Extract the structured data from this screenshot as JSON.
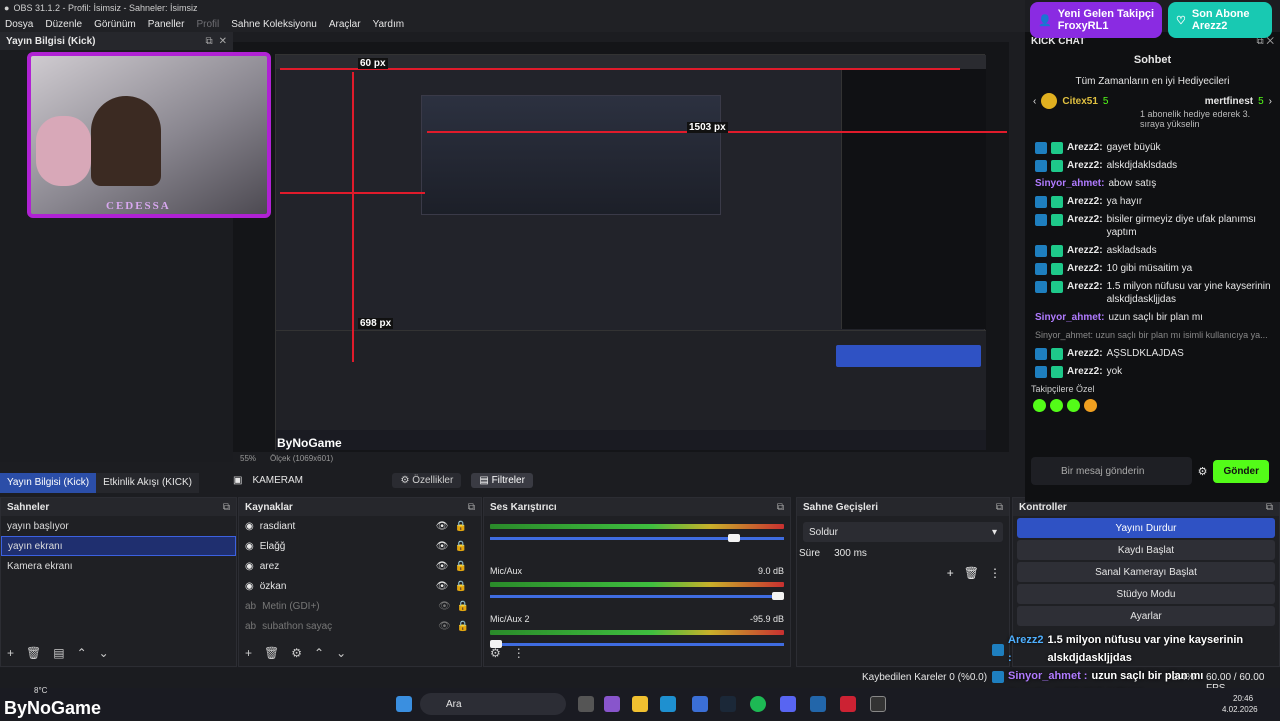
{
  "window": {
    "title": "OBS 31.1.2 - Profil: İsimsiz - Sahneler: İsimsiz"
  },
  "menu": [
    "Dosya",
    "Düzenle",
    "Görünüm",
    "Paneller",
    "Profil",
    "Sahne Koleksiyonu",
    "Araçlar",
    "Yardım"
  ],
  "info_dock": {
    "title": "Yayın Bilgisi (Kick)"
  },
  "preview": {
    "measure_top": "60 px",
    "measure_right": "1503 px",
    "measure_bottom": "698 px",
    "zoom": "55%",
    "scale": "Ölçek (1069x601)",
    "watermark": "ByNoGame"
  },
  "camera": {
    "tag": "CEDESSA"
  },
  "bottom_tabs": [
    "Yayın Bilgisi (Kick)",
    "Etkinlik Akışı (KICK)"
  ],
  "scene_bar": {
    "scene_name": "KAMERAM",
    "properties": "Özellikler",
    "filters": "Filtreler"
  },
  "scenes": {
    "title": "Sahneler",
    "items": [
      "yayın başlıyor",
      "yayın ekranı",
      "Kamera ekranı"
    ],
    "selected": 1
  },
  "sources": {
    "title": "Kaynaklar",
    "items": [
      {
        "name": "rasdiant",
        "dim": false
      },
      {
        "name": "Elağğ",
        "dim": false
      },
      {
        "name": "arez",
        "dim": false
      },
      {
        "name": "özkan",
        "dim": false
      },
      {
        "name": "Metin (GDI+)",
        "dim": true
      },
      {
        "name": "subathon sayaç",
        "dim": true
      }
    ]
  },
  "mixer": {
    "title": "Ses Karıştırıcı",
    "ticks": [
      "-60",
      "-55",
      "-50",
      "-45",
      "-40",
      "-35",
      "-30",
      "-25",
      "-20",
      "-15",
      "-10",
      "-5",
      "0"
    ],
    "tracks": [
      {
        "name": "",
        "db": "",
        "volume": 0.85
      },
      {
        "name": "Mic/Aux",
        "db": "9.0 dB",
        "volume": 1.0
      },
      {
        "name": "Mic/Aux 2",
        "db": "-95.9 dB",
        "volume": 0.03
      }
    ]
  },
  "transitions": {
    "title": "Sahne Geçişleri",
    "type": "Soldur",
    "duration_label": "Süre",
    "duration": "300 ms"
  },
  "controls": {
    "title": "Kontroller",
    "buttons": [
      "Yayını Durdur",
      "Kaydı Başlat",
      "Sanal Kamerayı Başlat",
      "Stüdyo Modu",
      "Ayarlar"
    ]
  },
  "chat": {
    "dock_title": "KICK CHAT",
    "header": "Sohbet",
    "top_title": "Tüm Zamanların en iyi Hediyecileri",
    "top1_name": "Citex51",
    "top1_count": "5",
    "top2_name": "mertfinest",
    "top2_count": "5",
    "top2_note": "1 abonelik hediye ederek 3. sıraya yükselin",
    "messages": [
      {
        "user": "Arezz2:",
        "text": "gayet büyük",
        "badges": true
      },
      {
        "user": "Arezz2:",
        "text": "alskdjdaklsdads",
        "badges": true
      },
      {
        "user": "Sinyor_ahmet:",
        "text": "abow satış",
        "badges": false
      },
      {
        "user": "Arezz2:",
        "text": "ya hayır",
        "badges": true
      },
      {
        "user": "Arezz2:",
        "text": "bisiler girmeyiz diye ufak planımsı yaptım",
        "badges": true
      },
      {
        "user": "Arezz2:",
        "text": "askladsads",
        "badges": true
      },
      {
        "user": "Arezz2:",
        "text": "10 gibi müsaitim ya",
        "badges": true
      },
      {
        "user": "Arezz2:",
        "text": "1.5 milyon nüfusu var yine kayserinin alskdjdaskljjdas",
        "badges": true
      },
      {
        "user": "Sinyor_ahmet:",
        "text": "uzun saçlı bir plan mı",
        "badges": false
      },
      {
        "user": "",
        "text": "Sinyor_ahmet: uzun saçlı bir plan mı isimli kullanıcıya ya...",
        "badges": false,
        "reply": true
      },
      {
        "user": "Arezz2:",
        "text": "AŞSLDKLAJDAS",
        "badges": true
      },
      {
        "user": "Arezz2:",
        "text": "yok",
        "badges": true
      }
    ],
    "subs_label": "Takipçilere Özel",
    "input_placeholder": "Bir mesaj gönderin",
    "send": "Gönder"
  },
  "alerts": {
    "follower_title": "Yeni Gelen Takipçi",
    "follower_name": "FroxyRL1",
    "sub_title": "Son Abone",
    "sub_name": "Arezz2"
  },
  "overlay_chat": [
    {
      "user": "Arezz2 :",
      "text": "1.5 milyon nüfusu var yine kayserinin alskdjdaskljjdas"
    },
    {
      "user": "Sinyor_ahmet :",
      "text": "uzun saçlı bir plan mı"
    },
    {
      "user": "Arezz2 :",
      "text": "AŞSLDKLAJDAS"
    },
    {
      "user": "Arezz2 :",
      "text": "yok"
    }
  ],
  "status": {
    "dropped": "Kaybedilen Kareler 0 (%0.0)",
    "cpu": "2.4%",
    "fps": "60.00 / 60.00 FPS"
  },
  "taskbar": {
    "weather": "8°C",
    "search": "Ara",
    "time": "20:46",
    "date": "4.02.2026",
    "logo": "ByNoGame"
  },
  "colors": {
    "accent": "#2f52c4",
    "kick_green": "#53fc18",
    "alert_purple": "#8a2be2",
    "alert_teal": "#18c9b2",
    "red_guide": "#e01b2b"
  }
}
